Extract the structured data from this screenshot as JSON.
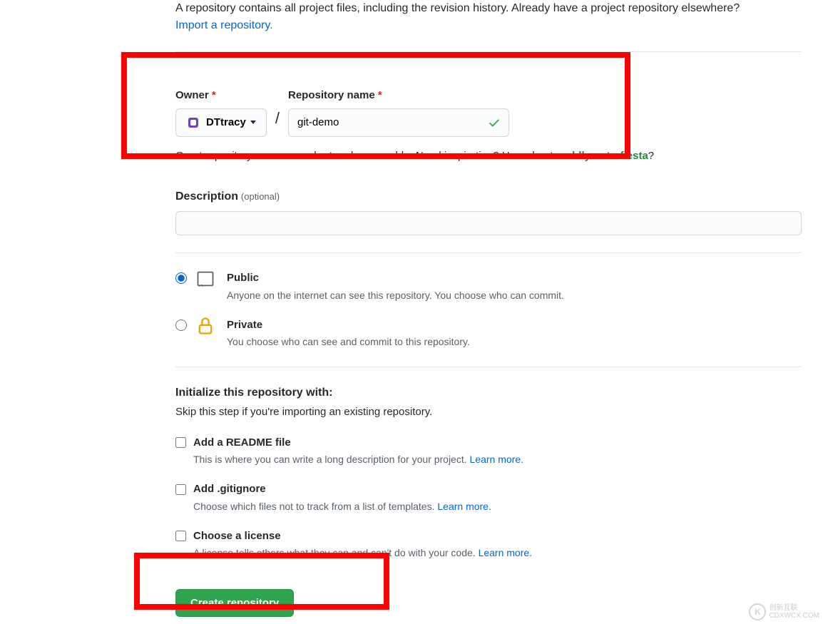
{
  "intro": {
    "text": "A repository contains all project files, including the revision history. Already have a project repository elsewhere?",
    "import_link": "Import a repository."
  },
  "owner": {
    "label": "Owner",
    "value": "DTtracy"
  },
  "repo_name": {
    "label": "Repository name",
    "value": "git-demo"
  },
  "hint": {
    "prefix": "Great repository names are short and memorable. Need inspiration? How about ",
    "suggestion": "cuddly-octo-fiesta",
    "suffix": "?"
  },
  "description": {
    "label": "Description",
    "optional": "(optional)",
    "value": ""
  },
  "visibility": {
    "public": {
      "title": "Public",
      "desc": "Anyone on the internet can see this repository. You choose who can commit."
    },
    "private": {
      "title": "Private",
      "desc": "You choose who can see and commit to this repository."
    }
  },
  "init": {
    "heading": "Initialize this repository with:",
    "subtext": "Skip this step if you're importing an existing repository.",
    "readme": {
      "label": "Add a README file",
      "desc": "This is where you can write a long description for your project. ",
      "learn_more": "Learn more."
    },
    "gitignore": {
      "label": "Add .gitignore",
      "desc": "Choose which files not to track from a list of templates. ",
      "learn_more": "Learn more."
    },
    "license": {
      "label": "Choose a license",
      "desc": "A license tells others what they can and can't do with your code. ",
      "learn_more": "Learn more."
    }
  },
  "create_button": "Create repository",
  "watermark": {
    "cn": "创新互联",
    "en": "CDXWCX.COM"
  }
}
